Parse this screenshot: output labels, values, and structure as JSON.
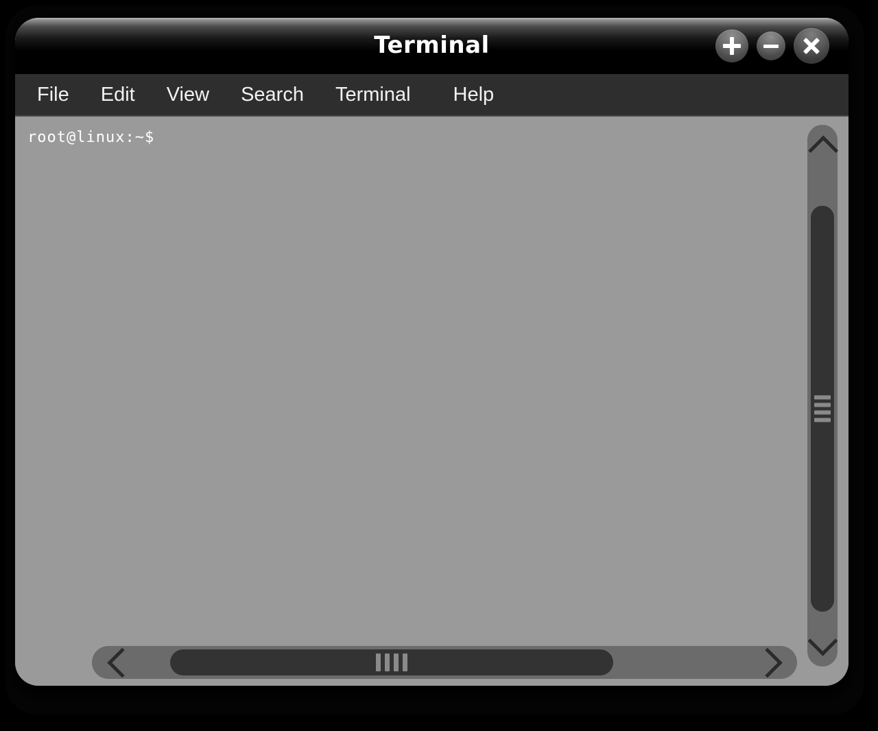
{
  "window": {
    "title": "Terminal",
    "controls": [
      {
        "name": "maximize-button",
        "icon": "plus-icon",
        "label": "+"
      },
      {
        "name": "minimize-button",
        "icon": "minus-icon",
        "label": "−"
      },
      {
        "name": "close-button",
        "icon": "close-icon",
        "label": "×"
      }
    ]
  },
  "menubar": {
    "items": [
      {
        "label": "File"
      },
      {
        "label": "Edit"
      },
      {
        "label": "View"
      },
      {
        "label": "Search"
      },
      {
        "label": "Terminal"
      },
      {
        "label": "Help"
      }
    ]
  },
  "terminal": {
    "prompt": "root@linux:~$",
    "background_color": "#9a9a9a",
    "text_color": "#ffffff"
  },
  "scrollbars": {
    "vertical": {
      "up_arrow": "∧",
      "down_arrow": "∨",
      "grip_count": 4
    },
    "horizontal": {
      "left_arrow": "‹",
      "right_arrow": "›",
      "grip_count": 4
    }
  },
  "colors": {
    "titlebar_top": "#b9b9b9",
    "titlebar_bottom": "#000000",
    "menubar": "#2e2e2e",
    "body": "#9a9a9a",
    "scroll_track": "#6b6b6b",
    "scroll_thumb": "#333333",
    "frame": "#000000"
  }
}
